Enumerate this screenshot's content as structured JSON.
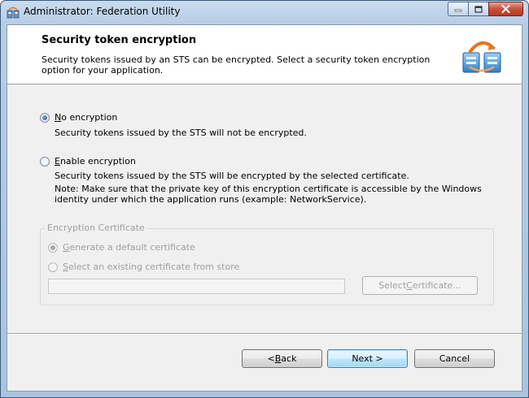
{
  "window": {
    "title": "Administrator: Federation Utility"
  },
  "header": {
    "title": "Security token encryption",
    "description": "Security tokens issued by an STS can be encrypted. Select a security token encryption option for your application."
  },
  "options": {
    "no_encryption": {
      "label_mnemonic": "N",
      "label_rest": "o encryption",
      "description": "Security tokens issued by the STS will not be encrypted.",
      "selected": true
    },
    "enable_encryption": {
      "label_mnemonic": "E",
      "label_rest": "nable encryption",
      "description": "Security tokens issued by the STS will be encrypted by the selected certificate.",
      "note": "Note: Make sure that the private key of this encryption certificate is accessible by the Windows identity under which the application runs (example: NetworkService).",
      "selected": false
    }
  },
  "certificate_group": {
    "title": "Encryption Certificate",
    "generate_default_mnemonic": "G",
    "generate_default_rest": "enerate a default certificate",
    "select_existing_mnemonic": "S",
    "select_existing_rest": "elect an existing certificate from store",
    "certificate_value": "",
    "select_button_pre": "Select ",
    "select_button_mnemonic": "C",
    "select_button_post": "ertificate..."
  },
  "buttons": {
    "back_pre": "< ",
    "back_mnemonic": "B",
    "back_post": "ack",
    "next": "Next >",
    "cancel": "Cancel"
  },
  "colors": {
    "accent": "#3c7fb1",
    "title_bar": "#b6cde6",
    "close_button": "#c74f3a",
    "disabled_text": "#a0a0a0"
  }
}
